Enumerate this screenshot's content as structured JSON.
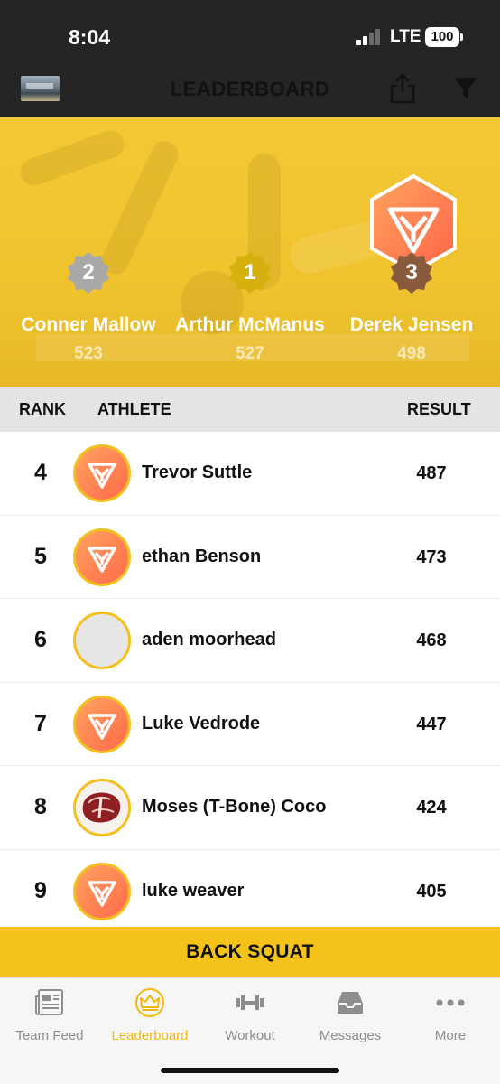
{
  "status_bar": {
    "time": "8:04",
    "network": "LTE",
    "battery": "100"
  },
  "header": {
    "title": "LEADERBOARD"
  },
  "podium": [
    {
      "rank": "2",
      "name": "Conner Mallow",
      "score": "523",
      "badge_color": "#a9a9a9"
    },
    {
      "rank": "1",
      "name": "Arthur McManus",
      "score": "527",
      "badge_color": "#d4b10f"
    },
    {
      "rank": "3",
      "name": "Derek Jensen",
      "score": "498",
      "badge_color": "#8a5a3c"
    }
  ],
  "table": {
    "headers": {
      "rank": "RANK",
      "athlete": "ATHLETE",
      "result": "RESULT"
    },
    "rows": [
      {
        "rank": "4",
        "name": "Trevor Suttle",
        "result": "487",
        "avatar": "logo"
      },
      {
        "rank": "5",
        "name": "ethan Benson",
        "result": "473",
        "avatar": "logo"
      },
      {
        "rank": "6",
        "name": "aden moorhead",
        "result": "468",
        "avatar": "blank"
      },
      {
        "rank": "7",
        "name": "Luke Vedrode",
        "result": "447",
        "avatar": "logo"
      },
      {
        "rank": "8",
        "name": "Moses (T-Bone) Coco",
        "result": "424",
        "avatar": "steak"
      },
      {
        "rank": "9",
        "name": "luke weaver",
        "result": "405",
        "avatar": "logo"
      }
    ]
  },
  "workout": {
    "label": "BACK SQUAT"
  },
  "tabs": [
    {
      "label": "Team Feed",
      "icon": "newspaper-icon"
    },
    {
      "label": "Leaderboard",
      "icon": "crown-icon",
      "active": true
    },
    {
      "label": "Workout",
      "icon": "dumbbell-icon"
    },
    {
      "label": "Messages",
      "icon": "inbox-icon"
    },
    {
      "label": "More",
      "icon": "more-dots-icon"
    }
  ],
  "colors": {
    "accent": "#f5c11b",
    "header_bg": "#252525",
    "logo_orange": "#ff6a4a"
  }
}
